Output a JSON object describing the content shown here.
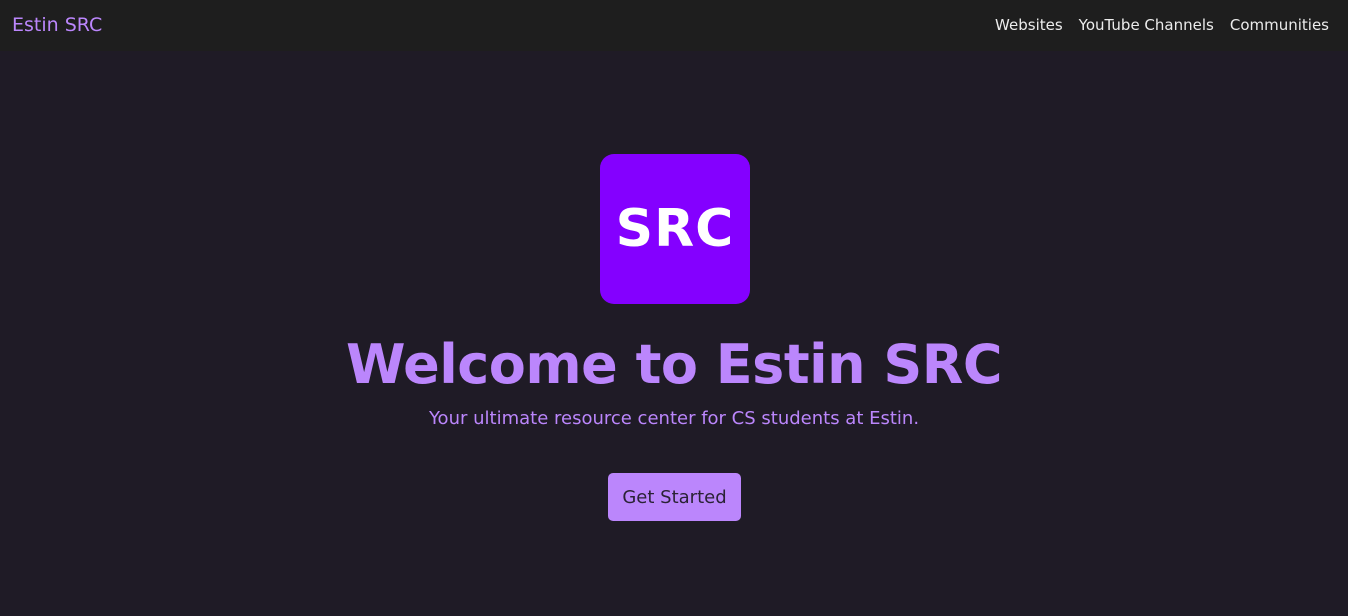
{
  "navbar": {
    "brand": "Estin SRC",
    "links": [
      "Websites",
      "YouTube Channels",
      "Communities"
    ]
  },
  "hero": {
    "logo_text": "SRC",
    "title": "Welcome to Estin SRC",
    "subtitle": "Your ultimate resource center for CS students at Estin.",
    "cta_label": "Get Started"
  },
  "colors": {
    "background": "#1f1b26",
    "navbar": "#1e1e1e",
    "accent": "#bb86fc",
    "logo_bg": "#8400ff"
  }
}
